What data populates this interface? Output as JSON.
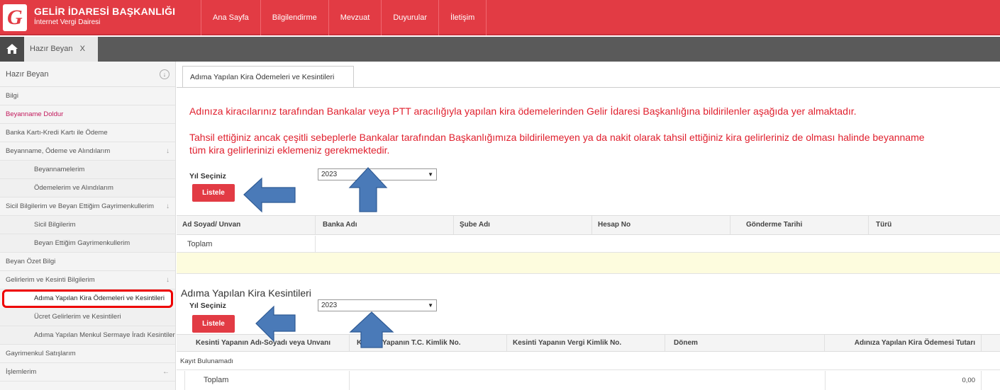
{
  "brand": {
    "title": "GELİR İDARESİ BAŞKANLIĞI",
    "subtitle": "İnternet Vergi Dairesi",
    "logo_letter": "G"
  },
  "nav": [
    "Ana Sayfa",
    "Bilgilendirme",
    "Mevzuat",
    "Duyurular",
    "İletişim"
  ],
  "tabbar": {
    "home_icon": "home-icon",
    "open_tab_label": "Hazır Beyan",
    "close_label": "X"
  },
  "sidebar": {
    "header": "Hazır Beyan",
    "header_icon": "↓",
    "items": [
      {
        "label": "Bilgi",
        "type": "item"
      },
      {
        "label": "Beyanname Doldur",
        "type": "item-red"
      },
      {
        "label": "Banka Kartı-Kredi Kartı ile Ödeme",
        "type": "item"
      },
      {
        "label": "Beyanname, Ödeme ve Alındılarım",
        "type": "item",
        "arrow": "↓"
      },
      {
        "label": "Beyannamelerim",
        "type": "sub"
      },
      {
        "label": "Ödemelerim ve Alındılarım",
        "type": "sub"
      },
      {
        "label": "Sicil Bilgilerim ve Beyan Ettiğim Gayrimenkullerim",
        "type": "item",
        "arrow": "↓"
      },
      {
        "label": "Sicil Bilgilerim",
        "type": "sub"
      },
      {
        "label": "Beyan Ettiğim Gayrimenkullerim",
        "type": "sub"
      },
      {
        "label": "Beyan Özet Bilgi",
        "type": "item"
      },
      {
        "label": "Gelirlerim ve Kesinti Bilgilerim",
        "type": "item",
        "arrow": "↓"
      },
      {
        "label": "Adıma Yapılan Kira Ödemeleri ve Kesintileri",
        "type": "active"
      },
      {
        "label": "Ücret Gelirlerim ve Kesintileri",
        "type": "sub"
      },
      {
        "label": "Adıma Yapılan Menkul Sermaye İradı Kesintileri",
        "type": "sub"
      },
      {
        "label": "Gayrimenkul Satışlarım",
        "type": "item"
      },
      {
        "label": "İşlemlerim",
        "type": "item",
        "arrow": "←"
      }
    ]
  },
  "content": {
    "tab_label": "Adıma Yapılan Kira Ödemeleri ve Kesintileri",
    "message1": "Adınıza kiracılarınız tarafından Bankalar veya PTT aracılığıyla yapılan kira ödemelerinden Gelir İdaresi Başkanlığına bildirilenler aşağıda yer almaktadır.",
    "message2_line1": "Tahsil ettiğiniz ancak çeşitli sebeplerle Bankalar tarafından Başkanlığımıza bildirilemeyen ya da nakit olarak tahsil ettiğiniz kira gelirleriniz de olması halinde beyanname",
    "message2_line2": "tüm kira gelirlerinizi eklemeniz gerekmektedir.",
    "section1": {
      "year_label": "Yıl Seçiniz",
      "year_value": "2023",
      "list_button": "Listele",
      "columns": [
        "Ad Soyad/ Unvan",
        "Banka Adı",
        "Şube Adı",
        "Hesap No",
        "Gönderme Tarihi",
        "Türü"
      ],
      "total_label": "Toplam"
    },
    "section2": {
      "title": "Adıma Yapılan Kira Kesintileri",
      "year_label": "Yıl Seçiniz",
      "year_value": "2023",
      "list_button": "Listele",
      "columns": [
        "Kesinti Yapanın Adı-Soyadı veya Unvanı",
        "Kesinti Yapanın T.C. Kimlik No.",
        "Kesinti Yapanın Vergi Kimlik No.",
        "Dönem",
        "Adınıza Yapılan Kira Ödemesi Tutarı"
      ],
      "empty_text": "Kayıt Bulunamadı",
      "total_label": "Toplam",
      "total_value": "0,00"
    }
  },
  "colors": {
    "brand_red": "#e23b44",
    "message_red": "#e0202e",
    "annotation_blue": "#4a7ab8"
  }
}
